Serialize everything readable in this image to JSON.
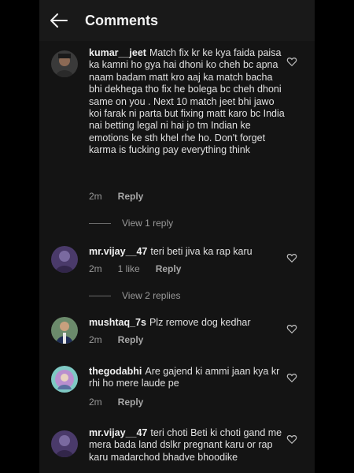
{
  "header": {
    "title": "Comments",
    "back_icon": "arrow-left-icon"
  },
  "comments": [
    {
      "username": "kumar__jeet",
      "text": "Match fix kr ke kya faida paisa ka kamni ho gya hai dhoni ko cheh bc apna naam badam matt kro aaj ka match bacha bhi dekhega tho fix he bolega bc cheh dhoni same on you . Next 10 match jeet bhi jawo koi farak ni parta but fixing matt karo bc India nai betting legal ni hai jo tm Indian ke emotions ke sth khel rhe ho. Don't forget karma is fucking pay everything think",
      "time": "2m",
      "likes": "",
      "reply_label": "Reply",
      "view_replies": "View 1 reply"
    },
    {
      "username": "mr.vijay__47",
      "text": "teri beti jiva ka rap karu",
      "time": "2m",
      "likes": "1 like",
      "reply_label": "Reply",
      "view_replies": "View 2 replies"
    },
    {
      "username": "mushtaq_7s",
      "text": "Plz remove dog kedhar",
      "time": "2m",
      "likes": "",
      "reply_label": "Reply",
      "view_replies": ""
    },
    {
      "username": "thegodabhi",
      "text": "Are gajend ki ammi jaan kya kr rhi ho mere laude pe",
      "time": "2m",
      "likes": "",
      "reply_label": "Reply",
      "view_replies": ""
    },
    {
      "username": "mr.vijay__47",
      "text": "teri choti Beti ki choti gand me mera bada land dslkr pregnant karu or rap karu madarchod bhadve bhoodike",
      "time": "",
      "likes": "",
      "reply_label": "",
      "view_replies": ""
    }
  ],
  "colors": {
    "background": "#141414",
    "header": "#191919",
    "text": "#e0e0e0",
    "muted": "#9a9a9a"
  },
  "icons": {
    "like": "heart-outline-icon",
    "back": "arrow-left-icon"
  }
}
